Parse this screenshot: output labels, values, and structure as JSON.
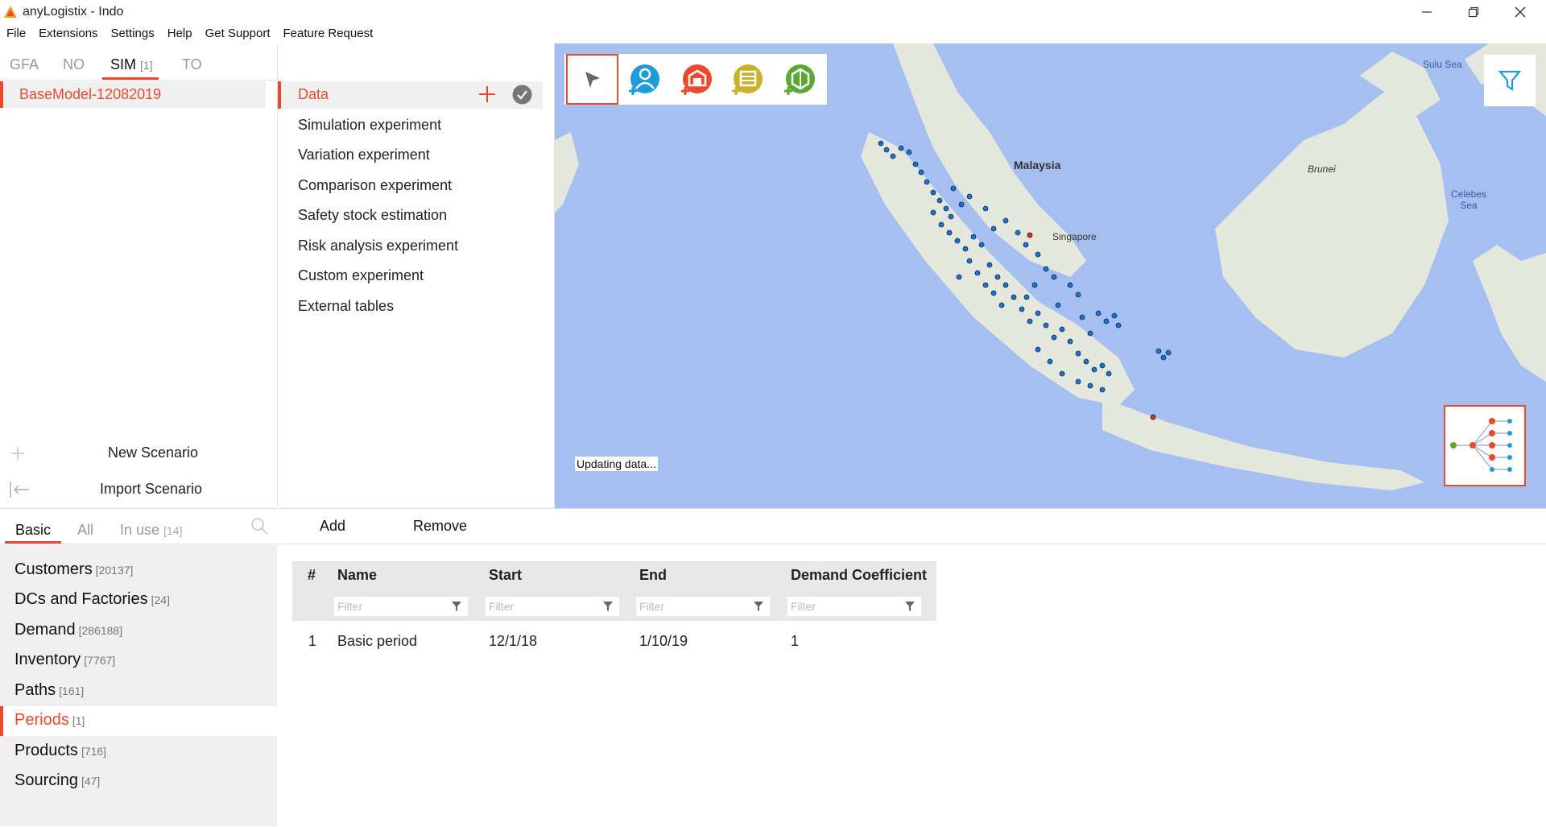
{
  "window": {
    "title": "anyLogistix - Indo",
    "controls": [
      "minimize",
      "restore",
      "close"
    ]
  },
  "menu": [
    "File",
    "Extensions",
    "Settings",
    "Help",
    "Get Support",
    "Feature Request"
  ],
  "scenario_tabs": [
    {
      "label": "GFA",
      "count": "",
      "active": false
    },
    {
      "label": "NO",
      "count": "",
      "active": false
    },
    {
      "label": "SIM",
      "count": "[1]",
      "active": true
    },
    {
      "label": "TO",
      "count": "",
      "active": false
    }
  ],
  "scenario": {
    "name": "BaseModel-12082019"
  },
  "scenario_actions": {
    "new": "New Scenario",
    "import": "Import Scenario"
  },
  "experiments": {
    "selected": "Data",
    "items": [
      "Simulation experiment",
      "Variation experiment",
      "Comparison experiment",
      "Safety stock estimation",
      "Risk analysis experiment",
      "Custom experiment",
      "External tables"
    ]
  },
  "map": {
    "status": "Updating data...",
    "labels": [
      "Malaysia",
      "Singapore",
      "Brunei",
      "Sulu Sea",
      "Celebes Sea"
    ],
    "toolbar_icons": [
      "select-arrow-icon",
      "add-customer-icon",
      "add-factory-icon",
      "add-dc-icon",
      "add-supplier-icon"
    ],
    "accent_color": "#e94a2e",
    "water_color": "#a5bff0",
    "land_color": "#e4e8dc",
    "marker_color": "#1e73c8"
  },
  "bottom_tabs": [
    {
      "label": "Basic",
      "count": "",
      "active": true
    },
    {
      "label": "All",
      "count": "",
      "active": false
    },
    {
      "label": "In use",
      "count": "[14]",
      "active": false
    }
  ],
  "categories": [
    {
      "label": "Customers",
      "count": "[20137]"
    },
    {
      "label": "DCs and Factories",
      "count": "[24]"
    },
    {
      "label": "Demand",
      "count": "[286188]"
    },
    {
      "label": "Inventory",
      "count": "[7767]"
    },
    {
      "label": "Paths",
      "count": "[161]"
    },
    {
      "label": "Periods",
      "count": "[1]",
      "selected": true
    },
    {
      "label": "Products",
      "count": "[716]"
    },
    {
      "label": "Sourcing",
      "count": "[47]"
    }
  ],
  "table_actions": {
    "add": "Add",
    "remove": "Remove"
  },
  "table": {
    "columns": [
      "#",
      "Name",
      "Start",
      "End",
      "Demand Coefficient"
    ],
    "filter_placeholder": "Filter",
    "rows": [
      [
        "1",
        "Basic period",
        "12/1/18",
        "1/10/19",
        "1"
      ]
    ]
  }
}
